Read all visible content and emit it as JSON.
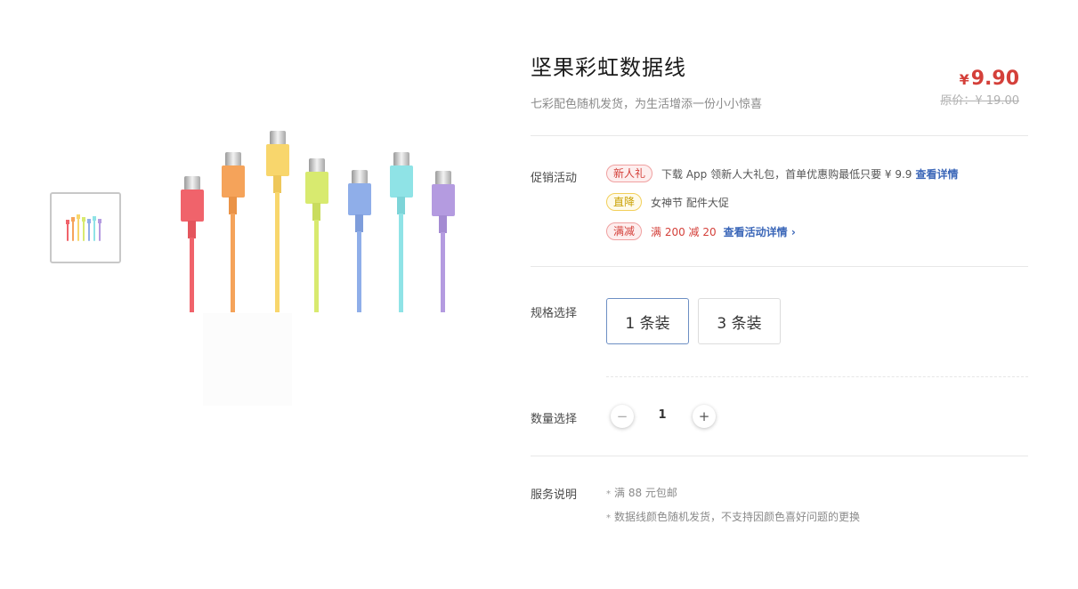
{
  "product": {
    "title": "坚果彩虹数据线",
    "subtitle": "七彩配色随机发货，为生活增添一份小小惊喜",
    "price_currency": "¥",
    "price": "9.90",
    "original_price": "原价：¥ 19.00",
    "cable_colors": [
      "#f0636b",
      "#f5a35a",
      "#f8d66c",
      "#d8ea6f",
      "#8faee9",
      "#8fe3e6",
      "#b49be0"
    ]
  },
  "promotions": {
    "label": "促销活动",
    "items": [
      {
        "badge": "新人礼",
        "text": "下载 App 领新人大礼包，首单优惠购最低只要 ¥ 9.9",
        "link": "查看详情"
      },
      {
        "badge": "直降",
        "text": "女神节 配件大促"
      },
      {
        "badge": "满减",
        "text": "满 200 减 20",
        "link": "查看活动详情 ›"
      }
    ]
  },
  "specs": {
    "label": "规格选择",
    "options": [
      "1 条装",
      "3 条装"
    ],
    "selected": "1 条装"
  },
  "quantity": {
    "label": "数量选择",
    "minus": "−",
    "value": "1",
    "plus": "+"
  },
  "service": {
    "label": "服务说明",
    "star": "*",
    "items": [
      "满 88 元包邮",
      "数据线颜色随机发货，不支持因颜色喜好问题的更换"
    ]
  }
}
